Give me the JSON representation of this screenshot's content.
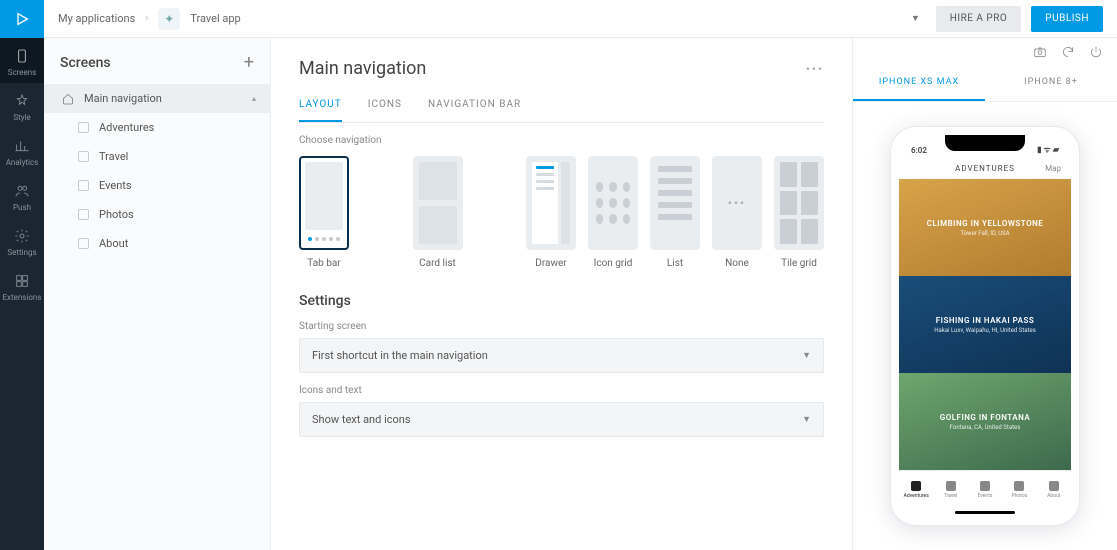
{
  "breadcrumb": {
    "root": "My applications",
    "app": "Travel app"
  },
  "actions": {
    "hire": "HIRE A PRO",
    "publish": "PUBLISH"
  },
  "rail": [
    {
      "label": "Screens"
    },
    {
      "label": "Style"
    },
    {
      "label": "Analytics"
    },
    {
      "label": "Push"
    },
    {
      "label": "Settings"
    },
    {
      "label": "Extensions"
    }
  ],
  "screens": {
    "title": "Screens",
    "items": [
      {
        "label": "Main navigation",
        "children": [
          {
            "label": "Adventures"
          },
          {
            "label": "Travel"
          },
          {
            "label": "Events"
          },
          {
            "label": "Photos"
          },
          {
            "label": "About"
          }
        ]
      }
    ]
  },
  "main": {
    "title": "Main navigation",
    "tabs": [
      "LAYOUT",
      "ICONS",
      "NAVIGATION BAR"
    ],
    "choose_label": "Choose navigation",
    "nav_options": [
      "Tab bar",
      "Card list",
      "Drawer",
      "Icon grid",
      "List",
      "None",
      "Tile grid"
    ],
    "settings_title": "Settings",
    "starting_label": "Starting screen",
    "starting_value": "First shortcut in the main navigation",
    "icons_label": "Icons and text",
    "icons_value": "Show text and icons"
  },
  "preview": {
    "devices": [
      "IPHONE XS MAX",
      "IPHONE 8+"
    ],
    "time": "6:02",
    "header": "ADVENTURES",
    "header_right": "Map",
    "cards": [
      {
        "title": "CLIMBING IN YELLOWSTONE",
        "sub": "Tower Fall, ID, USA"
      },
      {
        "title": "FISHING IN HAKAI PASS",
        "sub": "Hakai Luxv, Waipahu, HI, United States"
      },
      {
        "title": "GOLFING IN FONTANA",
        "sub": "Fontana, CA, United States"
      }
    ],
    "tabs": [
      "Adventures",
      "Travel",
      "Events",
      "Photos",
      "About"
    ]
  }
}
